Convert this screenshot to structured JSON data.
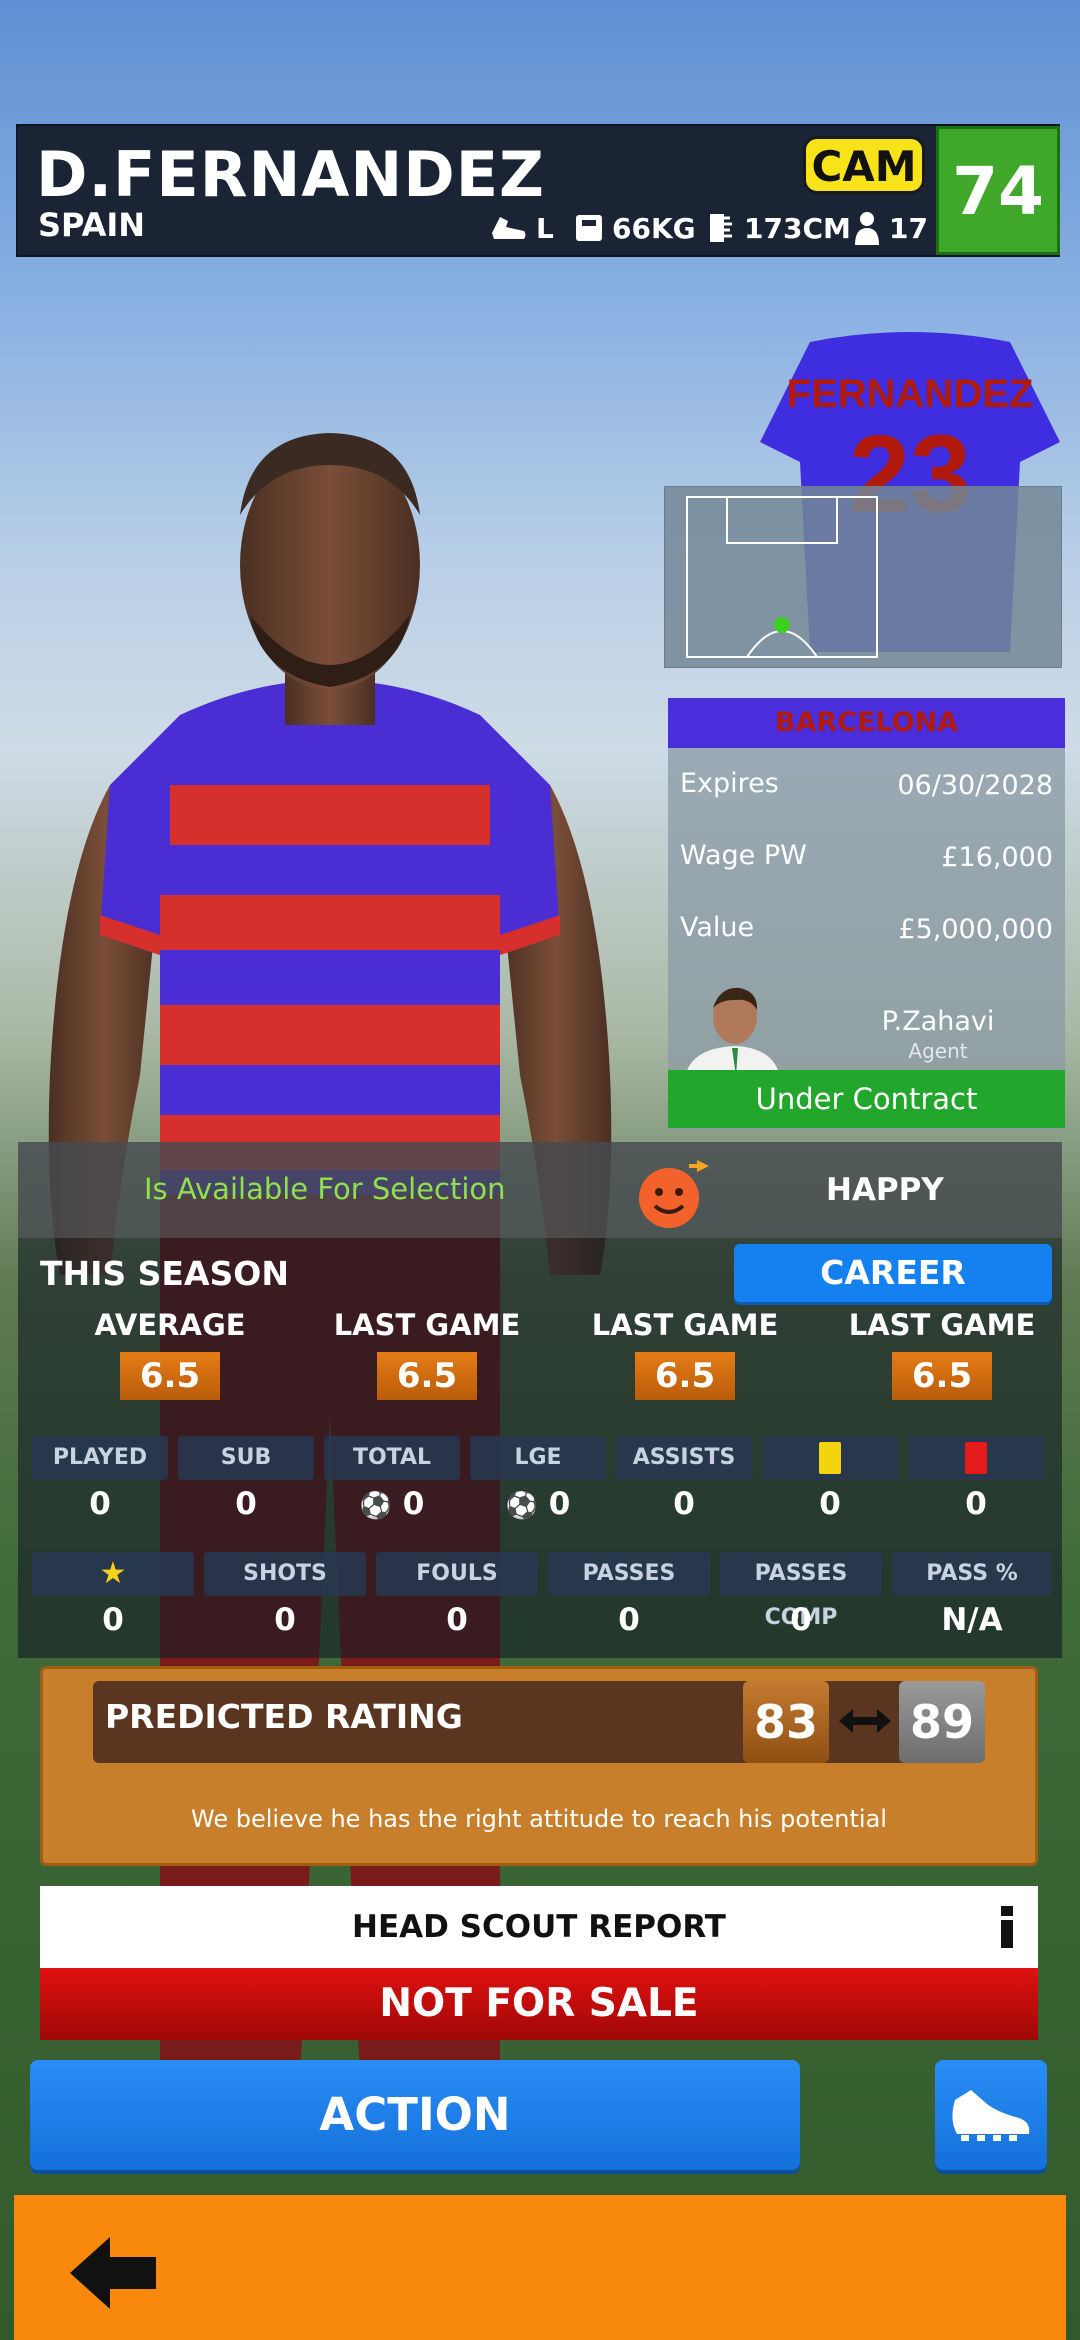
{
  "player": {
    "name": "D.FERNANDEZ",
    "nation": "SPAIN",
    "foot": "L",
    "weight": "66KG",
    "height": "173CM",
    "age": "17",
    "position": "CAM",
    "overall": "74"
  },
  "shirt": {
    "name": "FERNANDEZ",
    "number": "23"
  },
  "contract": {
    "club": "BARCELONA",
    "rows": [
      {
        "label": "Expires",
        "value": "06/30/2028"
      },
      {
        "label": "Wage PW",
        "value": "£16,000"
      },
      {
        "label": "Value",
        "value": "£5,000,000"
      }
    ],
    "agent_name": "P.Zahavi",
    "agent_role": "Agent",
    "status": "Under Contract"
  },
  "availability": {
    "text": "Is Available For Selection",
    "mood": "HAPPY"
  },
  "season": {
    "title": "THIS SEASON",
    "career_label": "CAREER",
    "ratings": [
      {
        "label": "AVERAGE",
        "value": "6.5"
      },
      {
        "label": "LAST GAME",
        "value": "6.5"
      },
      {
        "label": "LAST GAME",
        "value": "6.5"
      },
      {
        "label": "LAST GAME",
        "value": "6.5"
      }
    ],
    "row1": [
      {
        "label": "PLAYED",
        "value": "0"
      },
      {
        "label": "SUB",
        "value": "0"
      },
      {
        "label": "TOTAL",
        "value": "0"
      },
      {
        "label": "LGE",
        "value": "0"
      },
      {
        "label": "ASSISTS",
        "value": "0"
      },
      {
        "label": "",
        "value": "0"
      },
      {
        "label": "",
        "value": "0"
      }
    ],
    "row2": [
      {
        "label": "",
        "value": "0"
      },
      {
        "label": "SHOTS",
        "value": "0"
      },
      {
        "label": "FOULS",
        "value": "0"
      },
      {
        "label": "PASSES",
        "value": "0"
      },
      {
        "label": "PASSES COMP",
        "value": "0"
      },
      {
        "label": "PASS %",
        "value": "N/A"
      }
    ]
  },
  "predicted": {
    "label": "PREDICTED RATING",
    "low": "83",
    "high": "89",
    "note": "We believe he has the right attitude to reach his potential"
  },
  "scout_label": "HEAD SCOUT REPORT",
  "sale_status": "NOT FOR SALE",
  "action_label": "ACTION",
  "colors": {
    "accent_blue": "#1580f0",
    "overall_green": "#3fa82a",
    "position_yellow": "#f8e21a",
    "bottom_orange": "#f8890c"
  }
}
